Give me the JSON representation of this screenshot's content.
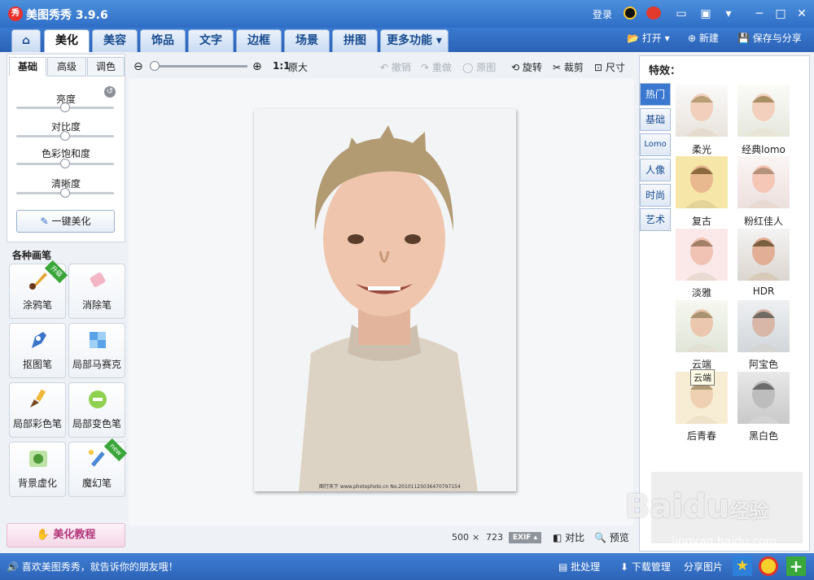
{
  "title": {
    "app": "美图秀秀 3.9.6",
    "logo": "秀",
    "login": "登录"
  },
  "tabs": [
    "美化",
    "美容",
    "饰品",
    "文字",
    "边框",
    "场景",
    "拼图",
    "更多功能"
  ],
  "toolbar": {
    "open": "打开",
    "new": "新建",
    "save": "保存与分享"
  },
  "adjust": {
    "tabs": [
      "基础",
      "高级",
      "调色"
    ],
    "sliders": [
      {
        "label": "亮度",
        "value": 0.5
      },
      {
        "label": "对比度",
        "value": 0.5
      },
      {
        "label": "色彩饱和度",
        "value": 0.5
      },
      {
        "label": "清晰度",
        "value": 0.5
      }
    ],
    "onekey": "一键美化"
  },
  "brushes": {
    "title": "各种画笔",
    "items": [
      "涂鸦笔",
      "消除笔",
      "抠图笔",
      "局部马赛克",
      "局部彩色笔",
      "局部变色笔",
      "背景虚化",
      "魔幻笔"
    ],
    "badge_upgrade": "升级",
    "badge_new": "new"
  },
  "tutorial": "美化教程",
  "canvas": {
    "zoom_label": "1:1",
    "original": "原大",
    "undo": "撤销",
    "redo": "重做",
    "orig_img": "原图",
    "rotate": "旋转",
    "crop": "裁剪",
    "size": "尺寸",
    "width": "500",
    "x": "×",
    "height": "723",
    "exif": "EXIF",
    "compare": "对比",
    "preview": "预览",
    "watermark": "图行天下 www.photophoto.cn No.20101125036470797154"
  },
  "effects": {
    "title": "特效：",
    "categories": [
      "热门",
      "基础",
      "Lomo",
      "人像",
      "时尚",
      "艺术"
    ],
    "items": [
      "柔光",
      "经典lomo",
      "复古",
      "粉红佳人",
      "淡雅",
      "HDR",
      "云端",
      "阿宝色",
      "后青春",
      "黑白色"
    ],
    "tooltip": "云端"
  },
  "status": {
    "share_text": "喜欢美图秀秀，就告诉你的朋友哦！",
    "batch": "批处理",
    "download": "下载管理",
    "share": "分享图片"
  },
  "watermark": {
    "text": "Bai",
    "dup": "du",
    "sub": "经验",
    "url": "jingyan.baidu.com"
  }
}
